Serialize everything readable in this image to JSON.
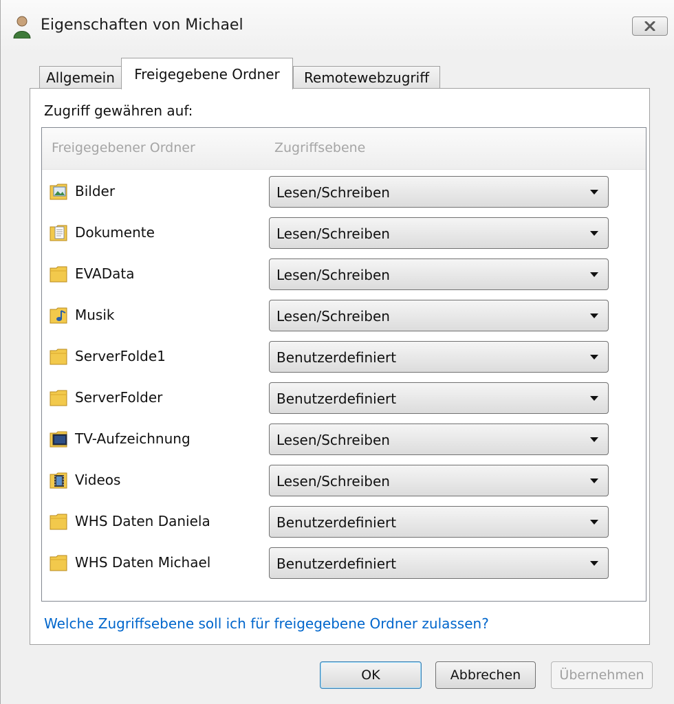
{
  "window": {
    "title": "Eigenschaften von Michael"
  },
  "tabs": [
    {
      "label": "Allgemein",
      "active": false
    },
    {
      "label": "Freigegebene Ordner",
      "active": true
    },
    {
      "label": "Remotewebzugriff",
      "active": false
    }
  ],
  "panel": {
    "grant_label": "Zugriff gewähren auf:",
    "columns": {
      "folder": "Freigegebener Ordner",
      "access": "Zugriffsebene"
    },
    "folders": [
      {
        "name": "Bilder",
        "access": "Lesen/Schreiben",
        "icon": "folder-pictures-icon"
      },
      {
        "name": "Dokumente",
        "access": "Lesen/Schreiben",
        "icon": "folder-documents-icon"
      },
      {
        "name": "EVAData",
        "access": "Lesen/Schreiben",
        "icon": "folder-icon"
      },
      {
        "name": "Musik",
        "access": "Lesen/Schreiben",
        "icon": "folder-music-icon"
      },
      {
        "name": "ServerFolde1",
        "access": "Benutzerdefiniert",
        "icon": "folder-icon"
      },
      {
        "name": "ServerFolder",
        "access": "Benutzerdefiniert",
        "icon": "folder-icon"
      },
      {
        "name": "TV-Aufzeichnung",
        "access": "Lesen/Schreiben",
        "icon": "folder-tv-icon"
      },
      {
        "name": "Videos",
        "access": "Lesen/Schreiben",
        "icon": "folder-videos-icon"
      },
      {
        "name": "WHS Daten Daniela",
        "access": "Benutzerdefiniert",
        "icon": "folder-icon"
      },
      {
        "name": "WHS Daten Michael",
        "access": "Benutzerdefiniert",
        "icon": "folder-icon"
      }
    ],
    "help_link": "Welche Zugriffsebene soll ich für freigegebene Ordner zulassen?"
  },
  "buttons": {
    "ok": "OK",
    "cancel": "Abbrechen",
    "apply": "Übernehmen"
  },
  "colors": {
    "link": "#0066cc",
    "folder": "#f2c94c"
  }
}
